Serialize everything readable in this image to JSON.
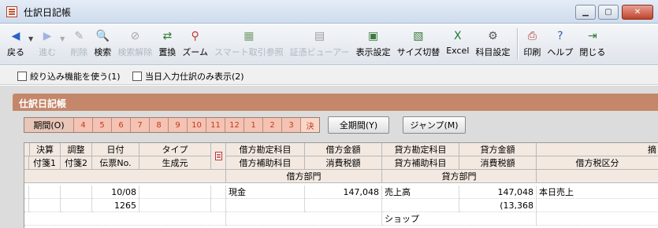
{
  "window": {
    "title": "仕訳日記帳",
    "controls": {
      "minimize": "▁",
      "maximize": "▢",
      "close": "✕"
    }
  },
  "toolbar": {
    "items": [
      {
        "label": "戻る",
        "icon": "back-arrow-icon",
        "glyph": "◀",
        "color": "#2a62c8",
        "enabled": true
      },
      {
        "label": "進む",
        "icon": "forward-arrow-icon",
        "glyph": "▶",
        "color": "#7e9cd8",
        "enabled": false
      },
      {
        "label": "削除",
        "icon": "delete-icon",
        "glyph": "✎",
        "color": "#888888",
        "enabled": false
      },
      {
        "label": "検索",
        "icon": "search-icon",
        "glyph": "🔍",
        "color": "#2e7d32",
        "enabled": true
      },
      {
        "label": "検索解除",
        "icon": "search-clear-icon",
        "glyph": "⊘",
        "color": "#888888",
        "enabled": false
      },
      {
        "label": "置換",
        "icon": "replace-icon",
        "glyph": "⇄",
        "color": "#2e7d32",
        "enabled": true
      },
      {
        "label": "ズーム",
        "icon": "zoom-icon",
        "glyph": "⚲",
        "color": "#c0392b",
        "enabled": true
      },
      {
        "label": "スマート取引参照",
        "icon": "smart-transaction-icon",
        "glyph": "▦",
        "color": "#4a7a3a",
        "enabled": false
      },
      {
        "label": "証憑ビューアー",
        "icon": "voucher-viewer-icon",
        "glyph": "▤",
        "color": "#777777",
        "enabled": false
      },
      {
        "label": "表示設定",
        "icon": "display-settings-icon",
        "glyph": "▣",
        "color": "#3d7a3d",
        "enabled": true
      },
      {
        "label": "サイズ切替",
        "icon": "size-toggle-icon",
        "glyph": "▧",
        "color": "#3d7a3d",
        "enabled": true
      },
      {
        "label": "Excel",
        "icon": "excel-icon",
        "glyph": "X",
        "color": "#1e7b34",
        "enabled": true
      },
      {
        "label": "科目設定",
        "icon": "account-settings-icon",
        "glyph": "⚙",
        "color": "#555555",
        "enabled": true
      },
      {
        "label": "印刷",
        "icon": "print-icon",
        "glyph": "⎙",
        "color": "#b03a2e",
        "enabled": true
      },
      {
        "label": "ヘルプ",
        "icon": "help-icon",
        "glyph": "?",
        "color": "#2a5db0",
        "enabled": true
      },
      {
        "label": "閉じる",
        "icon": "close-door-icon",
        "glyph": "⇥",
        "color": "#2e7d32",
        "enabled": true
      }
    ]
  },
  "options": {
    "filter_label": "絞り込み機能を使う(1)",
    "today_only_label": "当日入力仕訳のみ表示(2)"
  },
  "section": {
    "title": "仕訳日記帳"
  },
  "period": {
    "label": "期間(O)",
    "months": [
      "4",
      "5",
      "6",
      "7",
      "8",
      "9",
      "10",
      "11",
      "12",
      "1",
      "2",
      "3",
      "決"
    ],
    "all_period_button": "全期間(Y)",
    "jump_button": "ジャンプ(M)"
  },
  "table": {
    "header_row1": [
      "決算",
      "調整",
      "日付",
      "タイプ",
      "",
      "借方勘定科目",
      "借方金額",
      "貸方勘定科目",
      "貸方金額",
      "摘"
    ],
    "header_row2": [
      "付箋1",
      "付箋2",
      "伝票No.",
      "生成元",
      "",
      "借方補助科目",
      "消費税額",
      "貸方補助科目",
      "消費税額",
      "借方税区分"
    ],
    "header_row3": [
      "借方部門",
      "貸方部門"
    ],
    "row1": {
      "date": "10/08",
      "debit_account": "現金",
      "debit_amount": "147,048",
      "credit_account": "売上高",
      "credit_amount": "147,048",
      "memo": "本日売上"
    },
    "row2": {
      "voucher_no": "1265",
      "credit_tax": "(13,368"
    },
    "row3": {
      "credit_dept": "ショップ"
    }
  }
}
